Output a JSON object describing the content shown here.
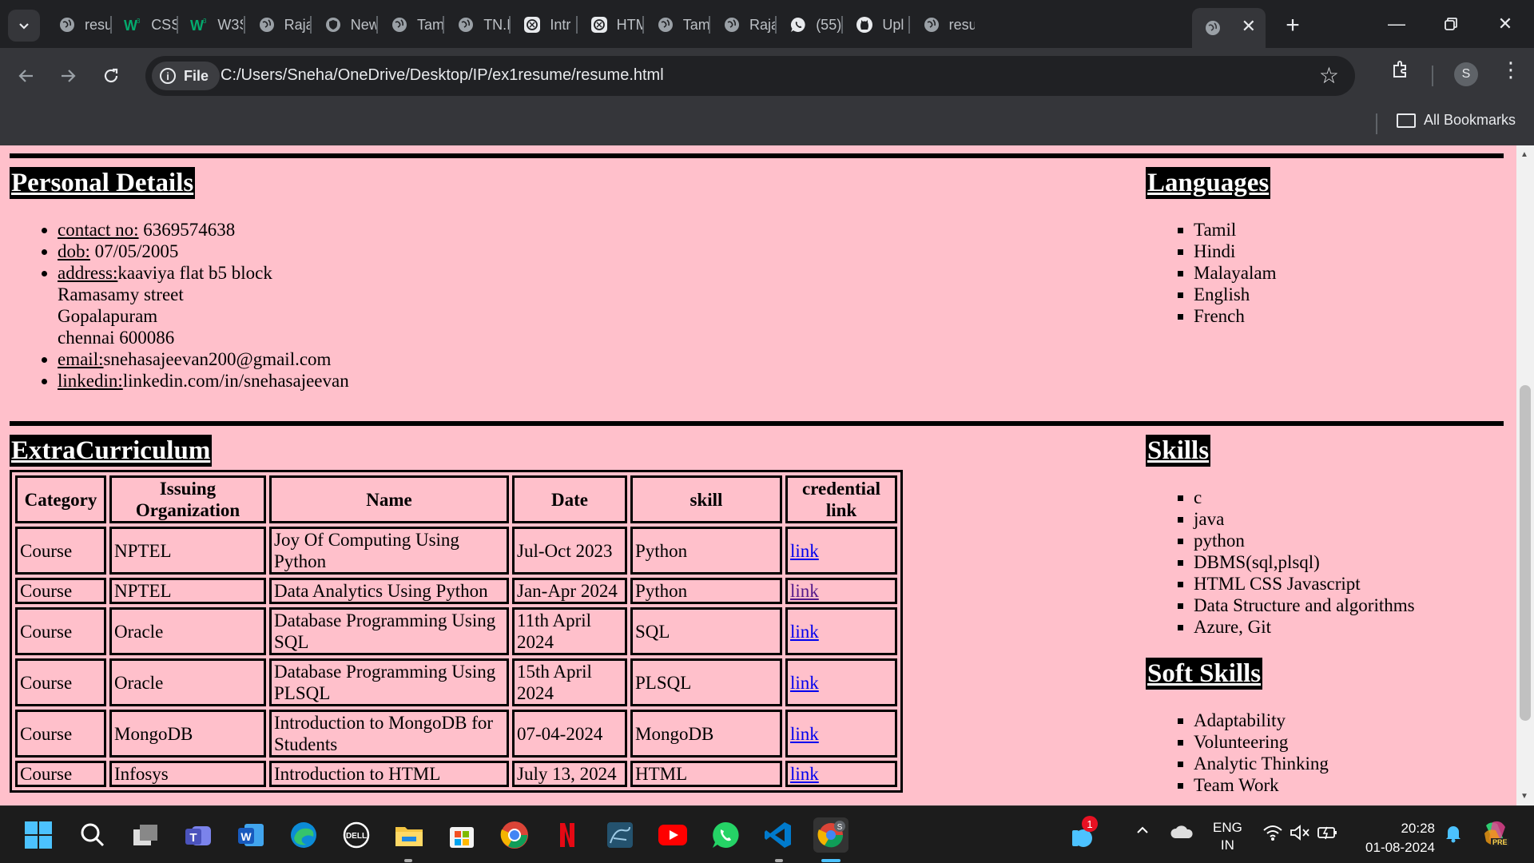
{
  "browser": {
    "tabs": [
      {
        "title": "resu",
        "icon": "globe-icon"
      },
      {
        "title": "CSS",
        "icon": "w3schools-icon"
      },
      {
        "title": "W3S",
        "icon": "w3schools-icon"
      },
      {
        "title": "Raja",
        "icon": "globe-icon"
      },
      {
        "title": "New",
        "icon": "shield-icon"
      },
      {
        "title": "Tam",
        "icon": "globe-icon"
      },
      {
        "title": "TN.I",
        "icon": "globe-icon"
      },
      {
        "title": "Intr",
        "icon": "chatgpt-icon"
      },
      {
        "title": "HTM",
        "icon": "chatgpt-icon"
      },
      {
        "title": "Tam",
        "icon": "globe-icon"
      },
      {
        "title": "Raja",
        "icon": "globe-icon"
      },
      {
        "title": "(55)",
        "icon": "whatsapp-icon"
      },
      {
        "title": "Upl",
        "icon": "github-icon"
      },
      {
        "title": "resu",
        "icon": "globe-icon"
      }
    ],
    "active_tab_icon": "globe-icon",
    "url_chip": "File",
    "url": "C:/Users/Sneha/OneDrive/Desktop/IP/ex1resume/resume.html",
    "profile_initial": "S",
    "all_bookmarks": "All Bookmarks"
  },
  "page": {
    "personal": {
      "heading": "Personal Details",
      "contact_label": "contact no:",
      "contact_value": " 6369574638",
      "dob_label": "dob:",
      "dob_value": " 07/05/2005",
      "address_label": "address:",
      "address_lines": [
        "kaaviya flat b5 block",
        "Ramasamy street",
        "Gopalapuram",
        "chennai 600086"
      ],
      "email_label": "email:",
      "email_value": "snehasajeevan200@gmail.com",
      "linkedin_label": "linkedin:",
      "linkedin_value": "linkedin.com/in/snehasajeevan"
    },
    "languages": {
      "heading": "Languages",
      "items": [
        "Tamil",
        "Hindi",
        "Malayalam",
        "English",
        "French"
      ]
    },
    "extra": {
      "heading": "ExtraCurriculum",
      "columns": [
        "Category",
        "Issuing Organization",
        "Name",
        "Date",
        "skill",
        "credential link"
      ],
      "rows": [
        {
          "category": "Course",
          "org": "NPTEL",
          "name": "Joy Of Computing Using Python",
          "date": "Jul-Oct 2023",
          "skill": "Python",
          "link": "link"
        },
        {
          "category": "Course",
          "org": "NPTEL",
          "name": "Data Analytics Using Python",
          "date": "Jan-Apr 2024",
          "skill": "Python",
          "link": "link"
        },
        {
          "category": "Course",
          "org": "Oracle",
          "name": "Database Programming Using SQL",
          "date": "11th April 2024",
          "skill": "SQL",
          "link": "link"
        },
        {
          "category": "Course",
          "org": "Oracle",
          "name": "Database Programming Using PLSQL",
          "date": "15th April 2024",
          "skill": "PLSQL",
          "link": "link"
        },
        {
          "category": "Course",
          "org": "MongoDB",
          "name": "Introduction to MongoDB for Students",
          "date": "07-04-2024",
          "skill": "MongoDB",
          "link": "link"
        },
        {
          "category": "Course",
          "org": "Infosys",
          "name": "Introduction to HTML",
          "date": "July 13, 2024",
          "skill": "HTML",
          "link": "link"
        }
      ]
    },
    "skills": {
      "heading": "Skills",
      "items": [
        "c",
        "java",
        "python",
        "DBMS(sql,plsql)",
        "HTML CSS Javascript",
        "Data Structure and algorithms",
        "Azure, Git"
      ]
    },
    "soft_skills": {
      "heading": "Soft Skills",
      "items": [
        "Adaptability",
        "Volunteering",
        "Analytic Thinking",
        "Team Work"
      ]
    }
  },
  "taskbar": {
    "apps": [
      "start-icon",
      "search-icon",
      "task-view-icon",
      "teams-icon",
      "word-icon",
      "edge-icon",
      "dell-icon",
      "file-explorer-icon",
      "store-icon",
      "chrome-icon",
      "netflix-icon",
      "mysql-workbench-icon",
      "youtube-icon",
      "whatsapp-icon",
      "vscode-icon",
      "chrome-profile-icon"
    ],
    "notification_badge": "1",
    "language_top": "ENG",
    "language_bottom": "IN",
    "time": "20:28",
    "date": "01-08-2024",
    "copilot_badge": "PRE"
  }
}
